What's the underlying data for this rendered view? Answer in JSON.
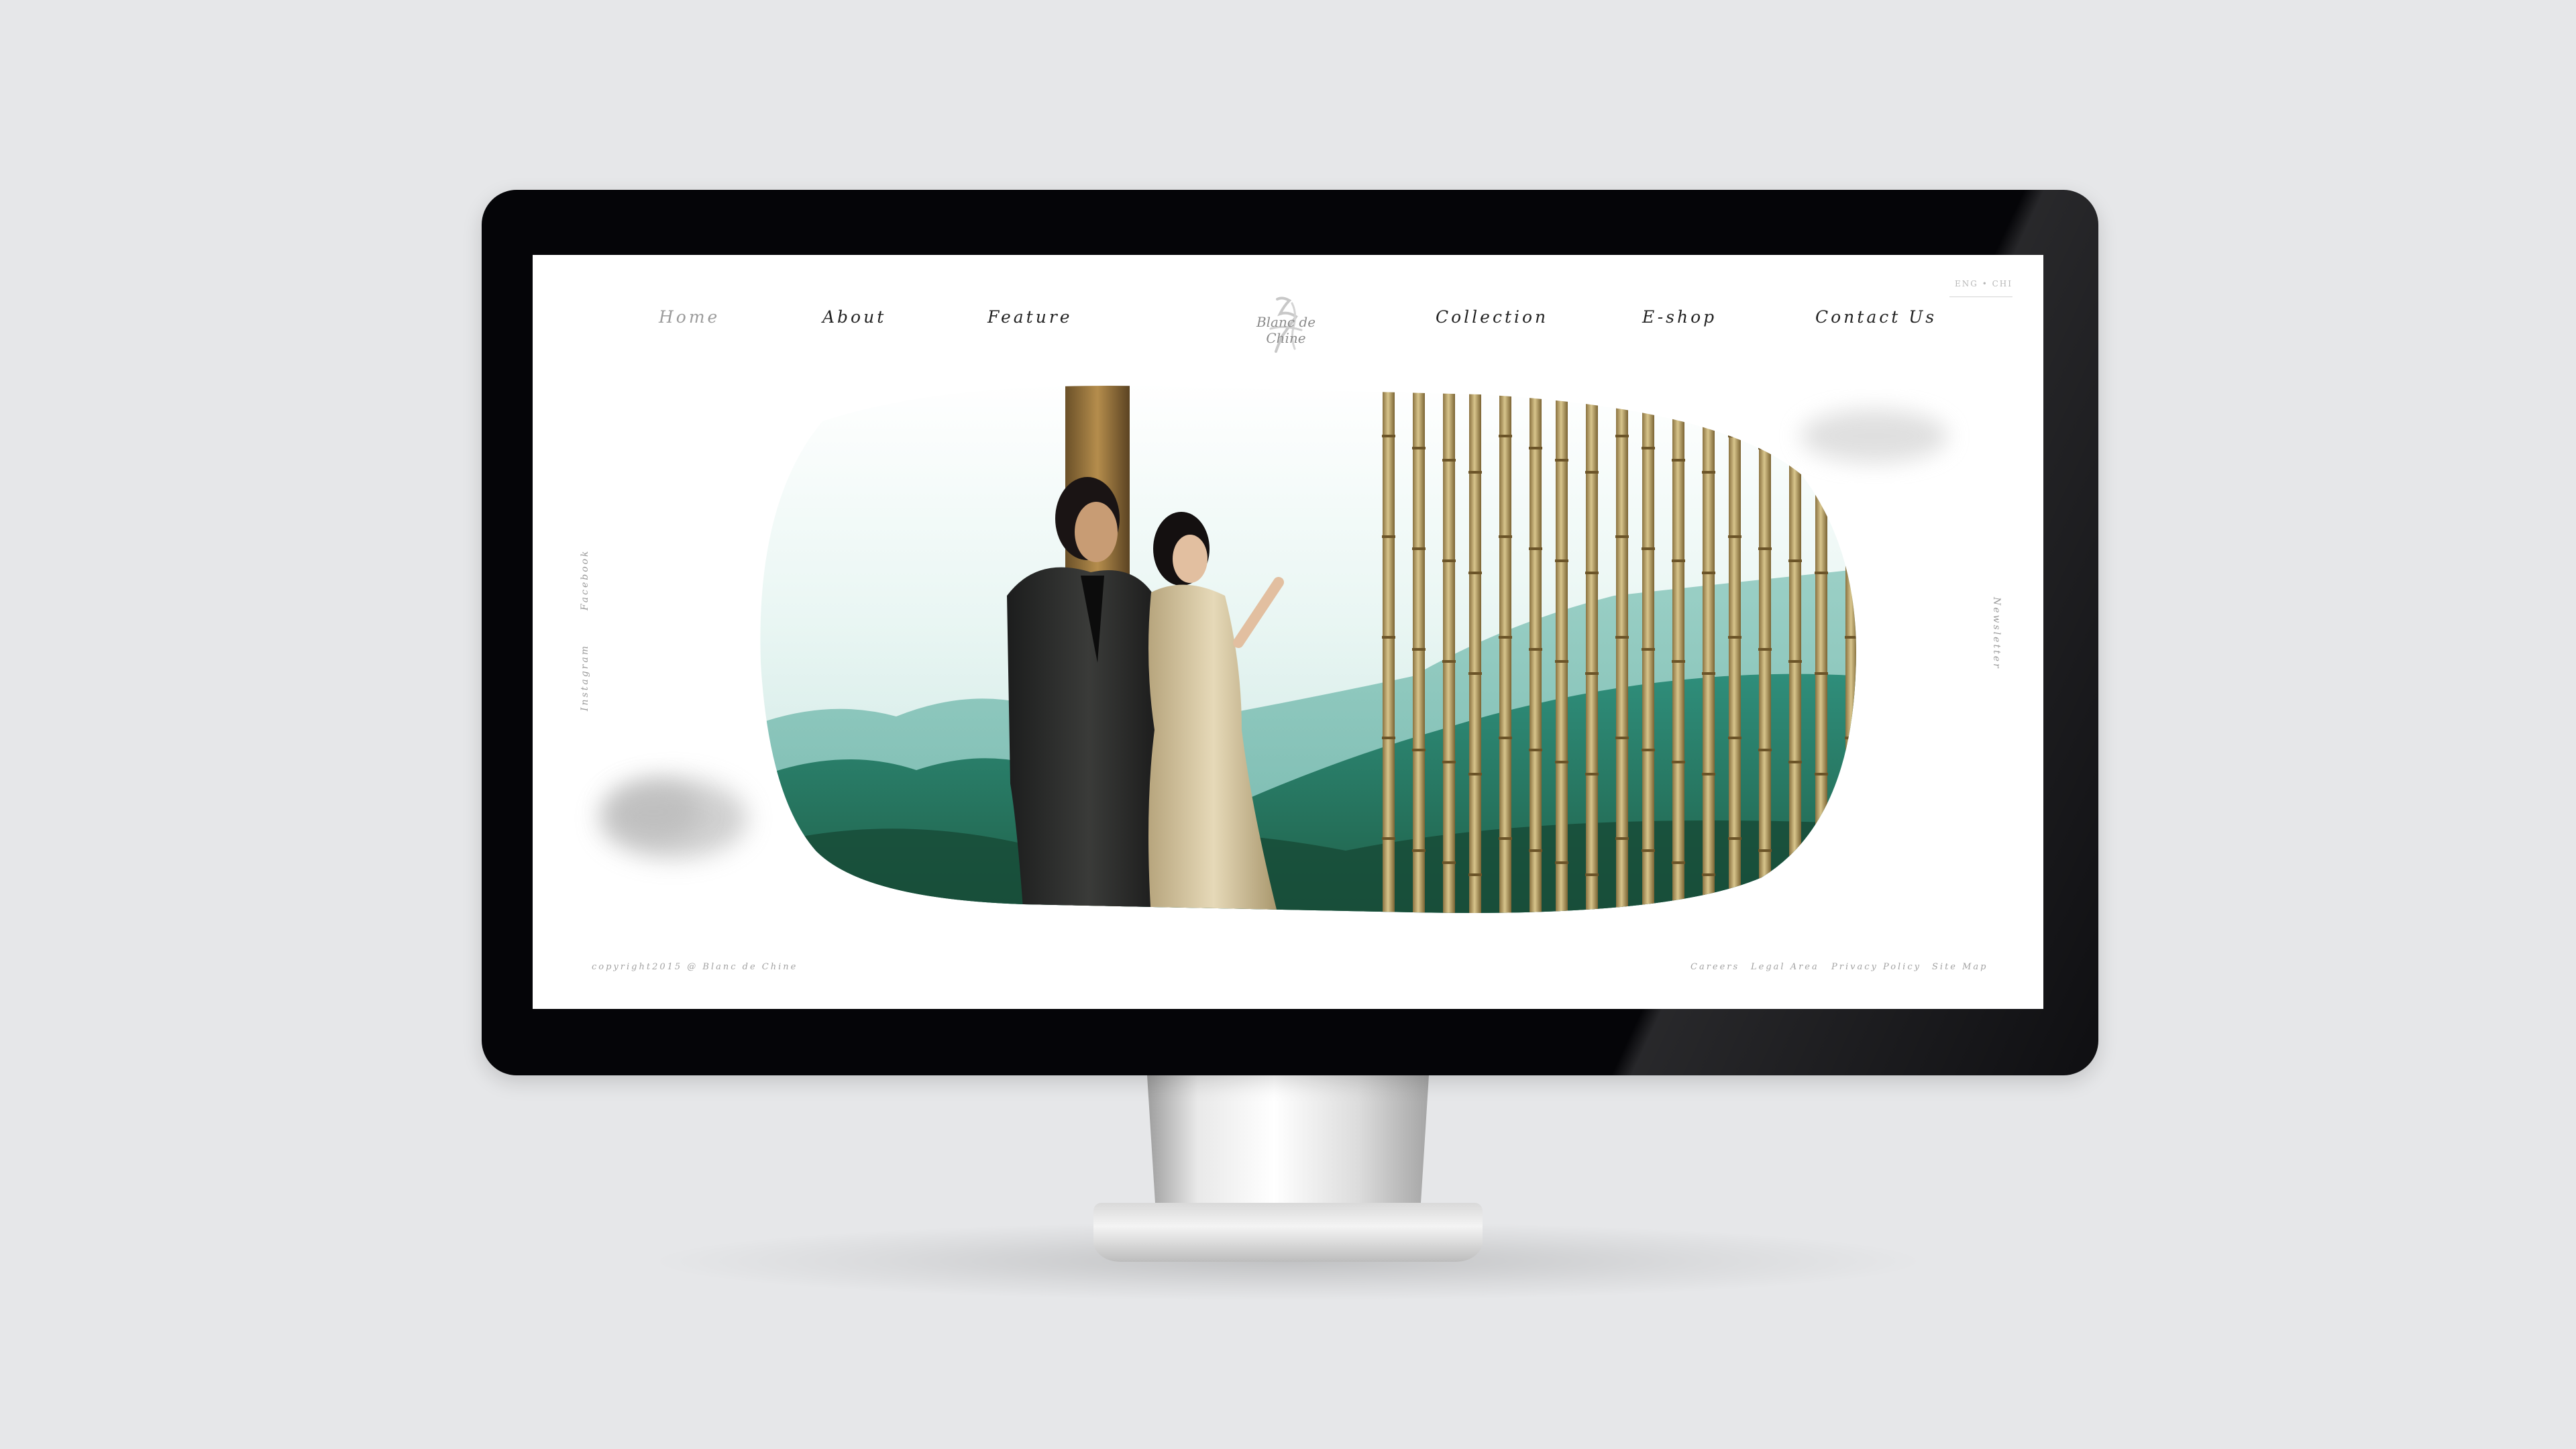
{
  "site": {
    "logo_text": "Blanc de Chine",
    "nav": {
      "home": "Home",
      "about": "About",
      "feature": "Feature",
      "collection": "Collection",
      "eshop": "E-shop",
      "contact": "Contact Us"
    },
    "language": "ENG • CHI",
    "social": {
      "facebook": "Facebook",
      "instagram": "Instagram"
    },
    "newsletter": "Newsletter",
    "footer": {
      "copyright": "copyright2015 @ Blanc de Chine",
      "links": [
        "Careers",
        "Legal Area",
        "Privacy Policy",
        "Site Map"
      ]
    }
  },
  "colors": {
    "bezel": "#050508",
    "backdrop": "#e6e7e9",
    "screen": "#ffffff",
    "nav_text": "#222222",
    "muted_text": "#9b9b9b",
    "bamboo": "#b59a55",
    "mountain": "#3f9c8a"
  },
  "icons": [
    "logo-calligraphy-icon"
  ]
}
